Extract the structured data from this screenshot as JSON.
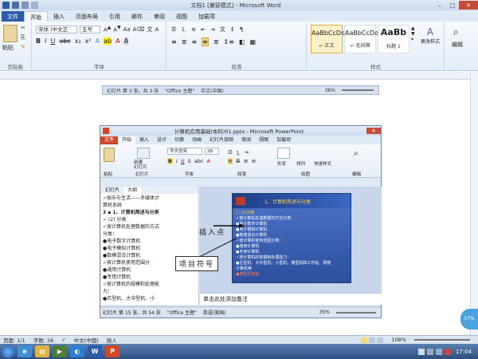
{
  "window": {
    "title": "文档1 [兼容模式] - Microsoft Word"
  },
  "tabs": [
    {
      "label": "文件"
    },
    {
      "label": "开始"
    },
    {
      "label": "插入"
    },
    {
      "label": "页面布局"
    },
    {
      "label": "引用"
    },
    {
      "label": "邮件"
    },
    {
      "label": "审阅"
    },
    {
      "label": "视图"
    },
    {
      "label": "加载项"
    }
  ],
  "ribbon": {
    "clipboard": {
      "paste_label": "粘贴",
      "group_label": "剪贴板"
    },
    "font": {
      "family": "宋体 (中文正",
      "size": "五号",
      "group_label": "字体"
    },
    "paragraph": {
      "group_label": "段落"
    },
    "styles": {
      "group_label": "样式",
      "tiles": [
        {
          "sample": "AaBbCcDd",
          "name": "↵ 正文"
        },
        {
          "sample": "AaBbCcDd",
          "name": "↵ 无间隔"
        },
        {
          "sample": "AaBb",
          "name": "标题 1"
        }
      ],
      "change_styles": "更改样式",
      "edit": "编辑"
    }
  },
  "pasted_strip": {
    "slide": "幻灯片 第 3 张，共 3 张",
    "theme": "\"Office 主题\"",
    "lang": "中文(中国)",
    "zoom": "36%"
  },
  "ppt": {
    "title": "计算机应用基础(本科)01.pptx - Microsoft PowerPoint",
    "tabs": [
      "文件",
      "开始",
      "插入",
      "设计",
      "切换",
      "动画",
      "幻灯片放映",
      "审阅",
      "视图",
      "加载项"
    ],
    "groups": {
      "clipboard": "粘贴",
      "slides": "幻灯片",
      "font": "字体",
      "paragraph": "段落",
      "drawing": "绘图",
      "edit": "编辑"
    },
    "ribbon_buttons": {
      "new_slide": "新建\n幻灯片",
      "font_family": "华文仿宋",
      "font_size": "28",
      "shape": "形状",
      "arrange": "排列",
      "quick_styles": "快速样式"
    },
    "outline_tabs": [
      "幻灯片",
      "大纲"
    ],
    "outline_lines": [
      "✓娱乐与生活——多媒体计",
      "  算机系统",
      "3 ▪ 1、计算机简述与分类",
      "   ✓ (2) 分类",
      "   ✓按计算机处理数据的方式",
      "     分类：",
      "     ●电子数字计算机",
      "     ●电子模拟计算机",
      "     ●数模混合计算机",
      "   ✓按计算机使用范围分",
      "     ●通用计算机",
      "     ●专用计算机",
      "   ✓按计算机的规模和处理能",
      "     力：",
      "     ●巨型机、大中型机、小"
    ],
    "slide": {
      "heading": "1、计算机简述与分类",
      "lines": [
        "□ (2)分类",
        "✓按计算机处理数据的方式分类：",
        "   ●电子数字计算机",
        "   ●电子模拟计算机",
        "   ●数模混合计算机",
        "✓按计算机使用范围分类：",
        "   ●通用计算机",
        "   ●专用计算机",
        "✓按计算机的规模和处理能力：",
        "   ●巨型机、大中型机、小型机、微型机和工作站、网络",
        "     计算机等",
        "   ●微型机基础"
      ]
    },
    "notes": "单击此处添加备注",
    "status": {
      "slide": "幻灯片 第 15 张，共 54 张",
      "theme": "\"Office 主题\"",
      "lang": "英语(美国)",
      "zoom": "35%"
    }
  },
  "callouts": {
    "insertion_point": "插入点",
    "bullet": "项目符号"
  },
  "word_status": {
    "page": "页面: 1/1",
    "words": "字数: 26",
    "lang": "中文(中国)",
    "mode": "插入",
    "zoom": "108%"
  },
  "taskbar": {
    "time": "17:04",
    "badge": "57%"
  },
  "colors": {
    "accent": "#2a5caa",
    "ppt_accent": "#d24726",
    "slide_bg": "#3a62b8"
  }
}
